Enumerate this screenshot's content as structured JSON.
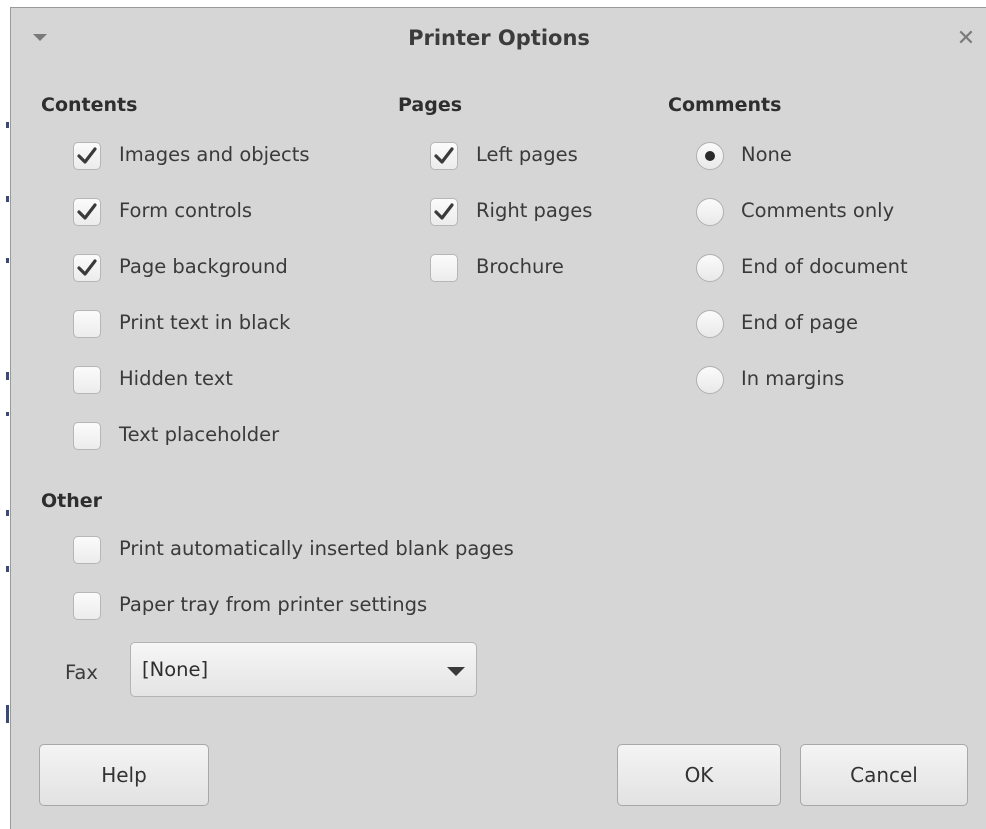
{
  "dialog": {
    "title": "Printer Options",
    "menu_icon": "triangle-down-icon",
    "close_icon": "close-x-icon",
    "close_glyph": "✕"
  },
  "contents": {
    "heading": "Contents",
    "items": [
      {
        "label": "Images and objects",
        "checked": true
      },
      {
        "label": "Form controls",
        "checked": true
      },
      {
        "label": "Page background",
        "checked": true
      },
      {
        "label": "Print text in black",
        "checked": false
      },
      {
        "label": "Hidden text",
        "checked": false
      },
      {
        "label": "Text placeholder",
        "checked": false
      }
    ]
  },
  "pages": {
    "heading": "Pages",
    "items": [
      {
        "label": "Left pages",
        "checked": true
      },
      {
        "label": "Right pages",
        "checked": true
      },
      {
        "label": "Brochure",
        "checked": false
      }
    ]
  },
  "comments": {
    "heading": "Comments",
    "items": [
      {
        "label": "None",
        "selected": true
      },
      {
        "label": "Comments only",
        "selected": false
      },
      {
        "label": "End of document",
        "selected": false
      },
      {
        "label": "End of page",
        "selected": false
      },
      {
        "label": "In margins",
        "selected": false
      }
    ]
  },
  "other": {
    "heading": "Other",
    "items": [
      {
        "label": "Print automatically inserted blank pages",
        "checked": false
      },
      {
        "label": "Paper tray from printer settings",
        "checked": false
      }
    ],
    "fax_label": "Fax",
    "fax_value": "[None]"
  },
  "buttons": {
    "help": "Help",
    "ok": "OK",
    "cancel": "Cancel"
  },
  "colors": {
    "dialog_bg": "#d6d6d6",
    "check_mark": "#3a3a3a"
  }
}
